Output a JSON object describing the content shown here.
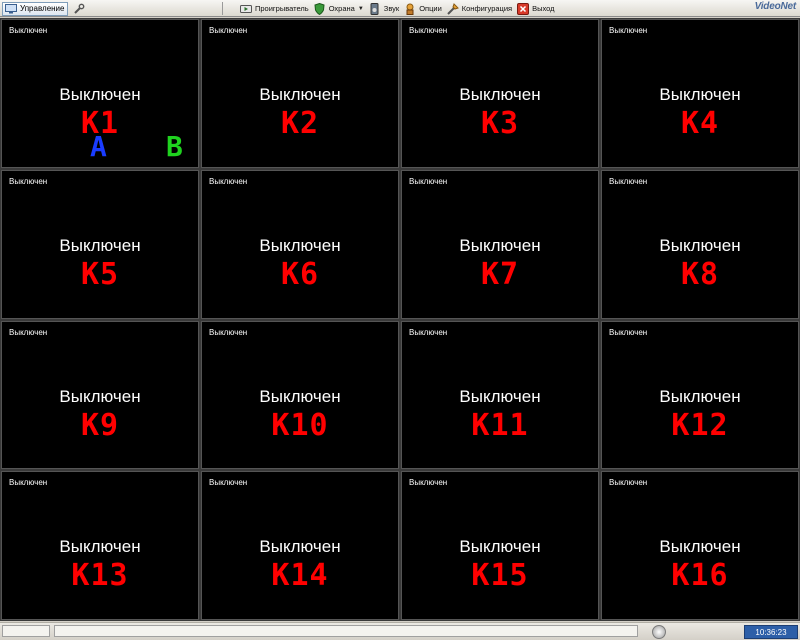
{
  "toolbar": {
    "manage_label": "Управление",
    "menu": [
      {
        "label": "Проигрыватель",
        "icon": "player-icon",
        "dropdown": false
      },
      {
        "label": "Охрана",
        "icon": "shield-icon",
        "dropdown": true
      },
      {
        "label": "Звук",
        "icon": "speaker-icon",
        "dropdown": false
      },
      {
        "label": "Опции",
        "icon": "options-icon",
        "dropdown": false
      },
      {
        "label": "Конфигурация",
        "icon": "config-icon",
        "dropdown": false
      },
      {
        "label": "Выход",
        "icon": "exit-icon",
        "dropdown": false
      }
    ],
    "brand": "VideoNet"
  },
  "cells": [
    {
      "status": "Выключен",
      "main": "Выключен",
      "label": "K1"
    },
    {
      "status": "Выключен",
      "main": "Выключен",
      "label": "K2"
    },
    {
      "status": "Выключен",
      "main": "Выключен",
      "label": "K3"
    },
    {
      "status": "Выключен",
      "main": "Выключен",
      "label": "K4"
    },
    {
      "status": "Выключен",
      "main": "Выключен",
      "label": "K5"
    },
    {
      "status": "Выключен",
      "main": "Выключен",
      "label": "K6"
    },
    {
      "status": "Выключен",
      "main": "Выключен",
      "label": "K7"
    },
    {
      "status": "Выключен",
      "main": "Выключен",
      "label": "K8"
    },
    {
      "status": "Выключен",
      "main": "Выключен",
      "label": "K9"
    },
    {
      "status": "Выключен",
      "main": "Выключен",
      "label": "K10"
    },
    {
      "status": "Выключен",
      "main": "Выключен",
      "label": "K11"
    },
    {
      "status": "Выключен",
      "main": "Выключен",
      "label": "K12"
    },
    {
      "status": "Выключен",
      "main": "Выключен",
      "label": "K13"
    },
    {
      "status": "Выключен",
      "main": "Выключен",
      "label": "K14"
    },
    {
      "status": "Выключен",
      "main": "Выключен",
      "label": "K15"
    },
    {
      "status": "Выключен",
      "main": "Выключен",
      "label": "K16"
    }
  ],
  "markers": [
    {
      "text": "A",
      "color": "#1a3cff"
    },
    {
      "text": "B",
      "color": "#1fd21f"
    }
  ],
  "colors": {
    "channel_label": "#ff0000",
    "cell_background": "#000000",
    "clock_background": "#2d5fa8"
  },
  "statusbar": {
    "clock": "10:36:23"
  }
}
